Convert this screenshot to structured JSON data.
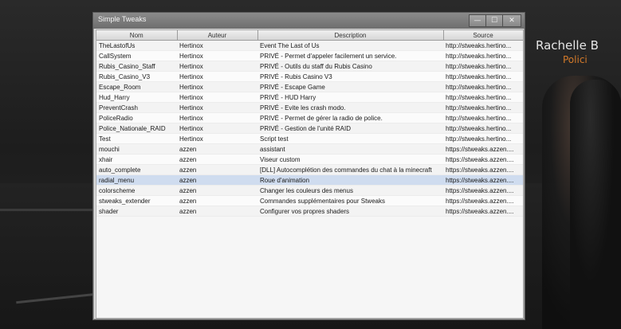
{
  "window": {
    "title": "Simple Tweaks",
    "minimize_glyph": "—",
    "maximize_glyph": "☐",
    "close_glyph": "✕"
  },
  "table": {
    "columns": [
      "Nom",
      "Auteur",
      "Description",
      "Source"
    ],
    "selected_index": 15,
    "rows": [
      {
        "nom": "TheLastofUs",
        "auteur": "Hertinox",
        "description": "Event The Last of Us",
        "source": "http://stweaks.hertino..."
      },
      {
        "nom": "CallSystem",
        "auteur": "Hertinox",
        "description": "PRIVÉ - Permet d'appeler facilement un service.",
        "source": "http://stweaks.hertino..."
      },
      {
        "nom": "Rubis_Casino_Staff",
        "auteur": "Hertinox",
        "description": "PRIVÉ - Outils du staff du Rubis Casino",
        "source": "http://stweaks.hertino..."
      },
      {
        "nom": "Rubis_Casino_V3",
        "auteur": "Hertinox",
        "description": "PRIVÉ - Rubis Casino V3",
        "source": "http://stweaks.hertino..."
      },
      {
        "nom": "Escape_Room",
        "auteur": "Hertinox",
        "description": "PRIVÉ - Escape Game",
        "source": "http://stweaks.hertino..."
      },
      {
        "nom": "Hud_Harry",
        "auteur": "Hertinox",
        "description": "PRIVÉ - HUD Harry",
        "source": "http://stweaks.hertino..."
      },
      {
        "nom": "PreventCrash",
        "auteur": "Hertinox",
        "description": "PRIVÉ - Evite les crash modo.",
        "source": "http://stweaks.hertino..."
      },
      {
        "nom": "PoliceRadio",
        "auteur": "Hertinox",
        "description": "PRIVÉ - Permet de gérer la radio de police.",
        "source": "http://stweaks.hertino..."
      },
      {
        "nom": "Police_Nationale_RAID",
        "auteur": "Hertinox",
        "description": "PRIVÉ - Gestion de l'unité RAID",
        "source": "http://stweaks.hertino..."
      },
      {
        "nom": "Test",
        "auteur": "Hertinox",
        "description": "Script test",
        "source": "http://stweaks.hertino..."
      },
      {
        "nom": "mouchi",
        "auteur": "azzen",
        "description": "assistant",
        "source": "https://stweaks.azzen...."
      },
      {
        "nom": "xhair",
        "auteur": "azzen",
        "description": "Viseur custom",
        "source": "https://stweaks.azzen...."
      },
      {
        "nom": "auto_complete",
        "auteur": "azzen",
        "description": "[DLL] Autocomplétion des commandes du chat à la minecraft",
        "source": "https://stweaks.azzen...."
      },
      {
        "nom": "radial_menu",
        "auteur": "azzen",
        "description": "Roue d'animation",
        "source": "https://stweaks.azzen...."
      },
      {
        "nom": "colorscheme",
        "auteur": "azzen",
        "description": "Changer les couleurs des menus",
        "source": "https://stweaks.azzen...."
      },
      {
        "nom": "stweaks_extender",
        "auteur": "azzen",
        "description": "Commandes supplémentaires pour Stweaks",
        "source": "https://stweaks.azzen...."
      },
      {
        "nom": "shader",
        "auteur": "azzen",
        "description": "Configurer vos propres shaders",
        "source": "https://stweaks.azzen...."
      }
    ]
  },
  "background": {
    "player_name": "Rachelle B",
    "player_rank": "Polici"
  },
  "colors": {
    "selected_row": "#cfdcef",
    "rank": "#d47a2a"
  }
}
